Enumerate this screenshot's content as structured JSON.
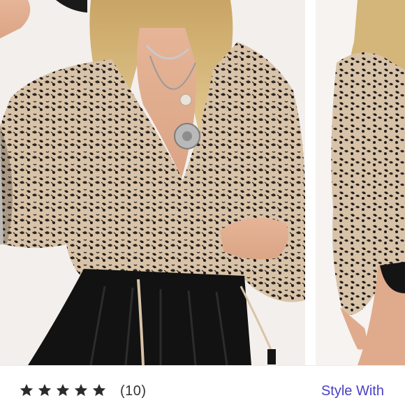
{
  "product_images": [
    {
      "alt": "model-wearing-printed-blouse-front"
    },
    {
      "alt": "model-wearing-printed-blouse-side"
    }
  ],
  "rating": {
    "stars": 5,
    "max_stars": 5,
    "review_count_text": "(10)"
  },
  "actions": {
    "style_with_label": "Style With"
  },
  "colors": {
    "accent": "#4a3fc6",
    "star": "#2b2b2b"
  },
  "icons": [
    "star-icon"
  ]
}
